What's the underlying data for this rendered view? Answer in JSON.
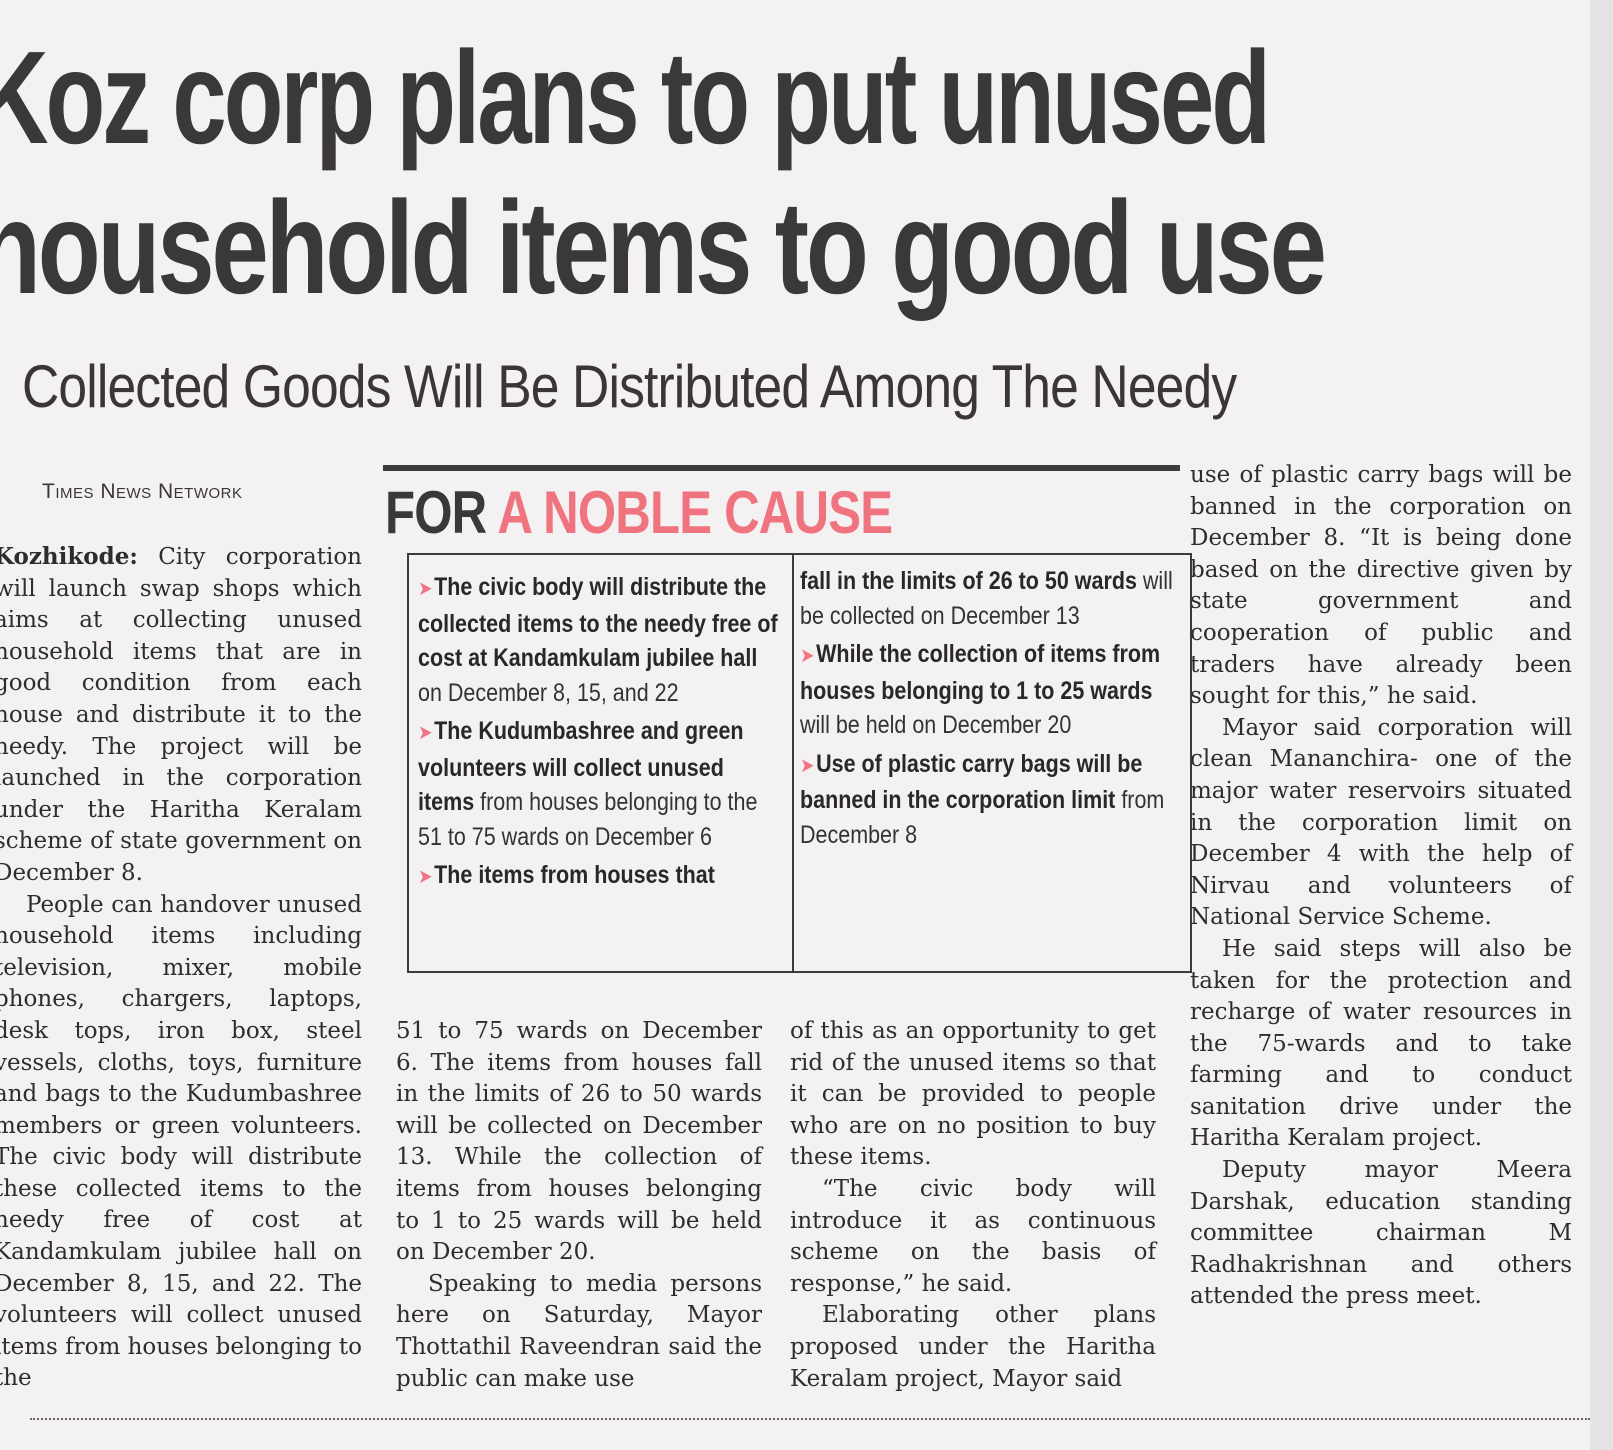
{
  "article": {
    "headline_line1": "Koz corp plans to put unused",
    "headline_line2": "household items to good use",
    "subheadline": "Collected Goods Will Be Distributed Among The Needy",
    "byline": "Times News Network",
    "col1": [
      {
        "lead": "Kozhikode:",
        "text": " City corporation will launch swap shops which aims at collecting unused household items that are in good condition from each house and distribute it to the needy. The project will be launched in the corporation under the Haritha Keralam scheme of state government on December 8."
      },
      {
        "lead": "",
        "text": "People can handover unused household items including television, mixer, mobile phones, chargers, laptops, desk tops, iron box, steel vessels, cloths, toys, furniture and bags to the Kudumbashree members or green volunteers. The civic body will distribute these collected items to the needy free of cost at Kandamkulam jubilee hall on December 8, 15, and 22. The volunteers will collect unused items from houses belonging to the"
      }
    ],
    "col2": [
      "51 to 75 wards on December 6. The items from houses fall in the limits of 26 to 50 wards will be collected on December 13. While the collection of items from houses belonging to 1 to 25 wards will be held on December 20.",
      "Speaking to media persons here on Saturday, Mayor Thottathil Raveendran said the public can make use"
    ],
    "col3": [
      "of this as an opportunity to get rid of the unused items so that it can be provided to people who are on no position to buy these items.",
      "“The civic body will introduce it as continuous scheme on the basis of response,” he said.",
      "Elaborating other plans proposed under the Haritha Keralam project, Mayor said"
    ],
    "col4": [
      "use of plastic carry bags will be banned in the corporation on December 8. “It is being done based on the directive given by state government and cooperation of public and traders have already been sought for this,” he said.",
      "Mayor said corporation will clean Mananchira- one of the major water reservoirs situated in the corporation limit on December 4 with the help of Nirvau and volunteers of National Service Scheme.",
      "He said steps will also be taken for the protection and recharge of water resources in the 75-wards and to take farming and to conduct sanitation drive under the Haritha Keralam project.",
      "Deputy mayor Meera Darshak, education standing committee chairman M Radhakrishnan and others attended the press meet."
    ]
  },
  "sidebar": {
    "title_part1": "FOR ",
    "title_part2": "A NOBLE CAUSE",
    "accent_color": "#f07480",
    "bullet_icon": "arrow-bullet-icon",
    "col1": [
      {
        "bullet": true,
        "bold": "The civic body will distribute the collected items to the needy free of cost at Kandamkulam jubilee hall",
        "normal": " on December 8, 15, and 22"
      },
      {
        "bullet": true,
        "bold": "The Kudumbashree and green volunteers will collect unused items",
        "normal": " from houses belonging to the 51 to 75 wards on December 6"
      },
      {
        "bullet": true,
        "bold": "The items from houses that",
        "normal": ""
      }
    ],
    "col2": [
      {
        "bullet": false,
        "bold": "fall in the limits of 26 to 50 wards",
        "normal": " will be collected on December 13"
      },
      {
        "bullet": true,
        "bold": "While the collection of items from houses belonging to 1 to 25 wards",
        "normal": " will be held on December 20"
      },
      {
        "bullet": true,
        "bold": "Use of plastic carry bags will be banned in the corporation limit",
        "normal": " from December 8"
      }
    ]
  }
}
